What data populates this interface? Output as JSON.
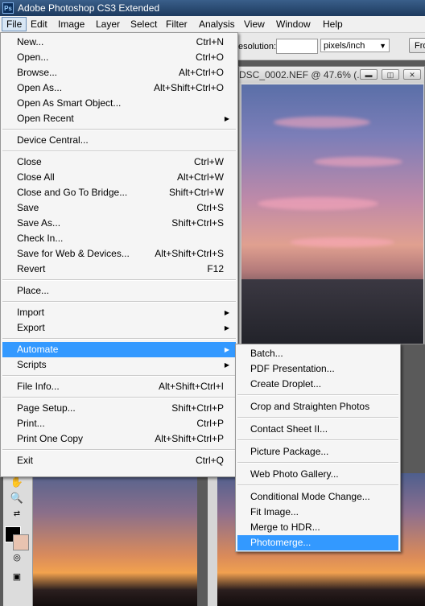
{
  "window": {
    "title": "Adobe Photoshop CS3 Extended",
    "logo_text": "Ps"
  },
  "menubar": [
    "File",
    "Edit",
    "Image",
    "Layer",
    "Select",
    "Filter",
    "Analysis",
    "View",
    "Window",
    "Help"
  ],
  "options_bar": {
    "resolution_label": "esolution:",
    "units": "pixels/inch",
    "button": "Fro"
  },
  "document": {
    "title": "DSC_0002.NEF @ 47.6% (...",
    "controls": [
      "minimize",
      "restore",
      "close"
    ]
  },
  "file_menu": [
    {
      "label": "New...",
      "shortcut": "Ctrl+N"
    },
    {
      "label": "Open...",
      "shortcut": "Ctrl+O"
    },
    {
      "label": "Browse...",
      "shortcut": "Alt+Ctrl+O"
    },
    {
      "label": "Open As...",
      "shortcut": "Alt+Shift+Ctrl+O"
    },
    {
      "label": "Open As Smart Object...",
      "shortcut": ""
    },
    {
      "label": "Open Recent",
      "shortcut": "",
      "submenu": true
    },
    {
      "separator": true
    },
    {
      "label": "Device Central...",
      "shortcut": ""
    },
    {
      "separator": true
    },
    {
      "label": "Close",
      "shortcut": "Ctrl+W"
    },
    {
      "label": "Close All",
      "shortcut": "Alt+Ctrl+W"
    },
    {
      "label": "Close and Go To Bridge...",
      "shortcut": "Shift+Ctrl+W"
    },
    {
      "label": "Save",
      "shortcut": "Ctrl+S"
    },
    {
      "label": "Save As...",
      "shortcut": "Shift+Ctrl+S"
    },
    {
      "label": "Check In...",
      "shortcut": ""
    },
    {
      "label": "Save for Web & Devices...",
      "shortcut": "Alt+Shift+Ctrl+S"
    },
    {
      "label": "Revert",
      "shortcut": "F12"
    },
    {
      "separator": true
    },
    {
      "label": "Place...",
      "shortcut": ""
    },
    {
      "separator": true
    },
    {
      "label": "Import",
      "shortcut": "",
      "submenu": true
    },
    {
      "label": "Export",
      "shortcut": "",
      "submenu": true
    },
    {
      "separator": true
    },
    {
      "label": "Automate",
      "shortcut": "",
      "submenu": true,
      "highlighted": true
    },
    {
      "label": "Scripts",
      "shortcut": "",
      "submenu": true
    },
    {
      "separator": true
    },
    {
      "label": "File Info...",
      "shortcut": "Alt+Shift+Ctrl+I"
    },
    {
      "separator": true
    },
    {
      "label": "Page Setup...",
      "shortcut": "Shift+Ctrl+P"
    },
    {
      "label": "Print...",
      "shortcut": "Ctrl+P"
    },
    {
      "label": "Print One Copy",
      "shortcut": "Alt+Shift+Ctrl+P"
    },
    {
      "separator": true
    },
    {
      "label": "Exit",
      "shortcut": "Ctrl+Q"
    }
  ],
  "automate_menu": [
    {
      "label": "Batch..."
    },
    {
      "label": "PDF Presentation..."
    },
    {
      "label": "Create Droplet..."
    },
    {
      "separator": true
    },
    {
      "label": "Crop and Straighten Photos"
    },
    {
      "separator": true
    },
    {
      "label": "Contact Sheet II..."
    },
    {
      "separator": true
    },
    {
      "label": "Picture Package..."
    },
    {
      "separator": true
    },
    {
      "label": "Web Photo Gallery..."
    },
    {
      "separator": true
    },
    {
      "label": "Conditional Mode Change..."
    },
    {
      "label": "Fit Image..."
    },
    {
      "label": "Merge to HDR..."
    },
    {
      "label": "Photomerge...",
      "highlighted": true
    }
  ],
  "colors": {
    "highlight": "#3399ff",
    "menu_bg": "#f5f5f5",
    "foreground_swatch": "#000000",
    "background_swatch": "#e8c3b0"
  }
}
